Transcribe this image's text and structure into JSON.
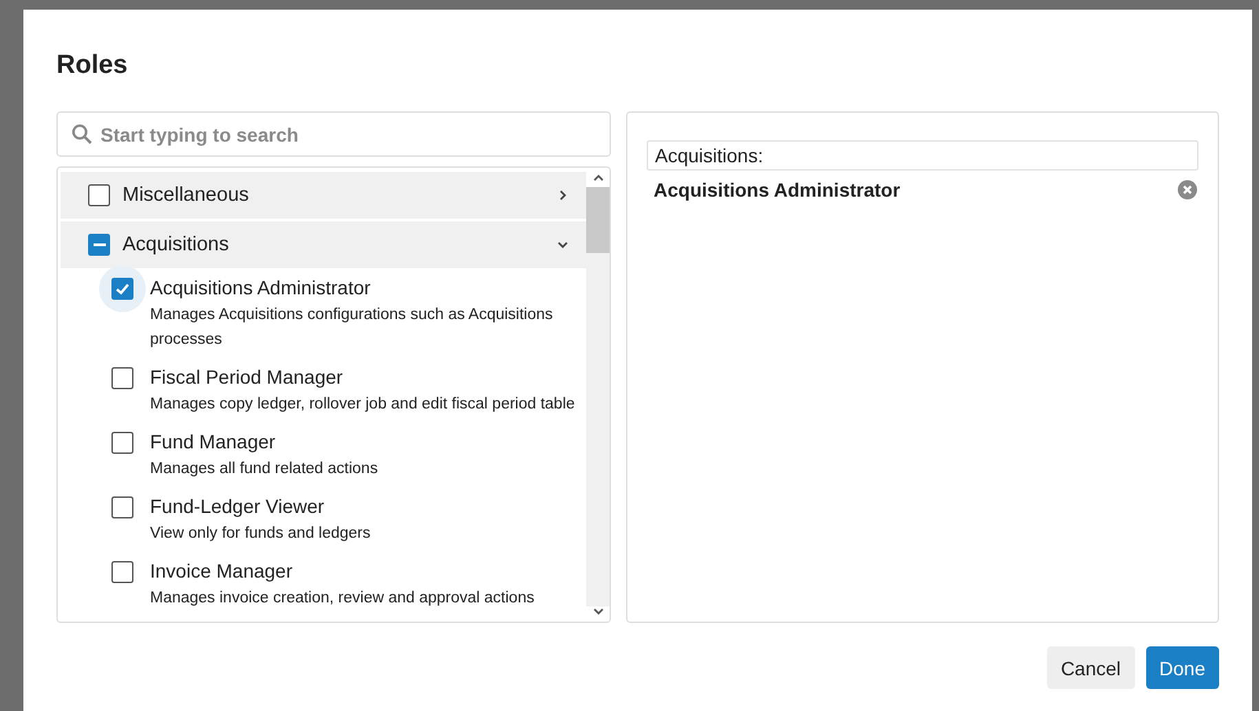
{
  "dialog": {
    "title": "Roles"
  },
  "search": {
    "placeholder": "Start typing to search"
  },
  "groups": [
    {
      "label": "Miscellaneous",
      "indeterminate": false,
      "expanded": false
    },
    {
      "label": "Acquisitions",
      "indeterminate": true,
      "expanded": true,
      "roles": [
        {
          "name": "Acquisitions Administrator",
          "description": "Manages Acquisitions configurations such as Acquisitions processes",
          "checked": true,
          "focused": true
        },
        {
          "name": "Fiscal Period Manager",
          "description": "Manages copy ledger, rollover job and edit fiscal period table",
          "checked": false,
          "focused": false
        },
        {
          "name": "Fund Manager",
          "description": "Manages all fund related actions",
          "checked": false,
          "focused": false
        },
        {
          "name": "Fund-Ledger Viewer",
          "description": "View only for funds and ledgers",
          "checked": false,
          "focused": false
        },
        {
          "name": "Invoice Manager",
          "description": "Manages invoice creation, review and approval actions",
          "checked": false,
          "focused": false
        }
      ]
    }
  ],
  "selected": [
    {
      "heading": "Acquisitions:",
      "items": [
        "Acquisitions Administrator"
      ]
    }
  ],
  "buttons": [
    {
      "label": "Cancel",
      "kind": "secondary"
    },
    {
      "label": "Done",
      "kind": "primary"
    }
  ]
}
